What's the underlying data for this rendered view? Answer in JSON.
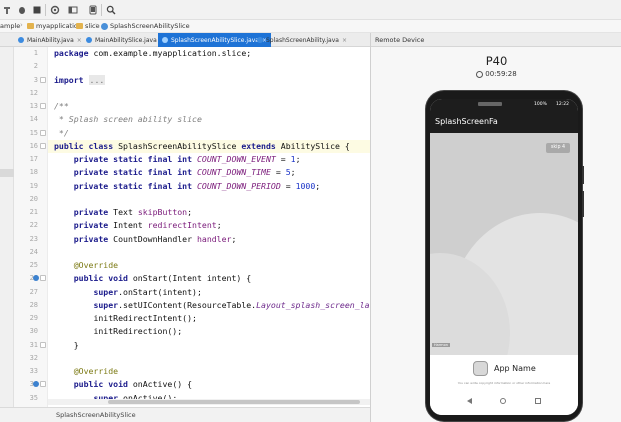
{
  "breadcrumb": {
    "items": [
      "ample",
      "myapplication",
      "slice",
      "SplashScreenAbilitySlice"
    ]
  },
  "tabs": [
    {
      "label": "MainAbility.java",
      "active": false
    },
    {
      "label": "MainAbilitySlice.java",
      "active": false
    },
    {
      "label": "SplashScreenAbilitySlice.java",
      "active": true
    },
    {
      "label": "SplashScreenAbility.java",
      "active": false
    }
  ],
  "editor": {
    "line_numbers": [
      "1",
      "2",
      "3",
      "12",
      "13",
      "14",
      "15",
      "16",
      "17",
      "18",
      "19",
      "20",
      "21",
      "22",
      "23",
      "24",
      "25",
      "26",
      "27",
      "28",
      "29",
      "30",
      "31",
      "32",
      "33",
      "34",
      "35"
    ],
    "code": {
      "l1_kw": "package",
      "l1_rest": " com.example.myapplication.slice;",
      "l3_kw": "import",
      "l3_fold": "...",
      "l13": "/**",
      "l14": " * Splash screen ability slice",
      "l15": " */",
      "l16_kw1": "public class",
      "l16_name": " SplashScreenAbilitySlice ",
      "l16_kw2": "extends",
      "l16_rest": " AbilitySlice {",
      "l17_kw": "private static final int",
      "l17_field": "COUNT_DOWN_EVENT",
      "l17_eq": " = ",
      "l17_num": "1",
      "l18_kw": "private static final int",
      "l18_field": "COUNT_DOWN_TIME",
      "l18_eq": " = ",
      "l18_num": "5",
      "l19_kw": "private static final int",
      "l19_field": "COUNT_DOWN_PERIOD",
      "l19_eq": " = ",
      "l19_num": "1000",
      "l21_kw": "private",
      "l21_type": " Text ",
      "l21_field": "skipButton",
      "l22_kw": "private",
      "l22_type": " Intent ",
      "l22_field": "redirectIntent",
      "l23_kw": "private",
      "l23_type": " CountDownHandler ",
      "l23_field": "handler",
      "l25_ann": "@Override",
      "l26_kw": "public void",
      "l26_rest": " onStart(Intent intent) {",
      "l27_kw": "super",
      "l27_rest": ".onStart(intent);",
      "l28_kw": "super",
      "l28_mid": ".setUIContent(ResourceTable.",
      "l28_res": "Layout_splash_screen_la",
      "l29": "initRedirectIntent();",
      "l30": "initRedirection();",
      "l31": "}",
      "l33_ann": "@Override",
      "l34_kw": "public void",
      "l34_rest": " onActive() {",
      "l35_kw": "super",
      "l35_rest": ".onActive();"
    }
  },
  "status": {
    "text": "SplashScreenAbilitySlice"
  },
  "remote_device": {
    "panel_title": "Remote Device",
    "device_name": "P40",
    "elapsed": "00:59:28"
  },
  "phone": {
    "status_time": "12:22",
    "battery": "100%",
    "app_title": "SplashScreenFa",
    "skip_label": "skip 4",
    "corner_tag": "Harmon",
    "app_name": "App Name",
    "app_desc": "You can write copyright information or other information here"
  }
}
